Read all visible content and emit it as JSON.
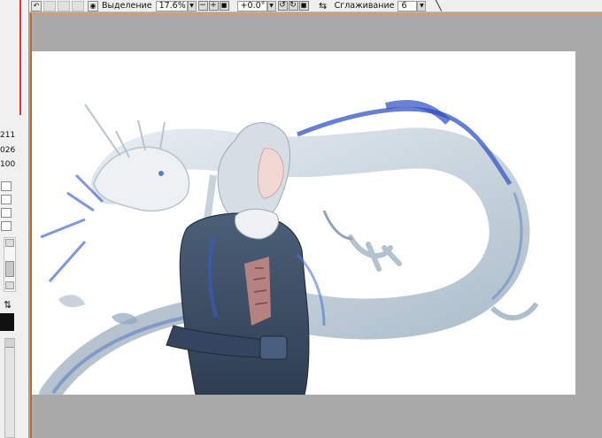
{
  "toolbar": {
    "selection_label": "Выделение",
    "zoom_value": "17.6%",
    "rotation_value": "+0.0°",
    "smoothing_label": "Сглаживание",
    "smoothing_value": "6",
    "minus_symbol": "−",
    "plus_symbol": "+"
  },
  "left_panel": {
    "values": [
      "211",
      "026",
      "100"
    ]
  },
  "icons": [
    "undo-icon",
    "eye-icon",
    "rotate-ccw-icon",
    "rotate-cw-icon",
    "flip-icon",
    "line-tool-icon",
    "swap-colors-icon"
  ],
  "colors": {
    "workspace_gray": "#a9a9a9",
    "canvas_white": "#ffffff",
    "toolbar_bg": "#efefef",
    "accent_orange": "#c06a2a"
  }
}
